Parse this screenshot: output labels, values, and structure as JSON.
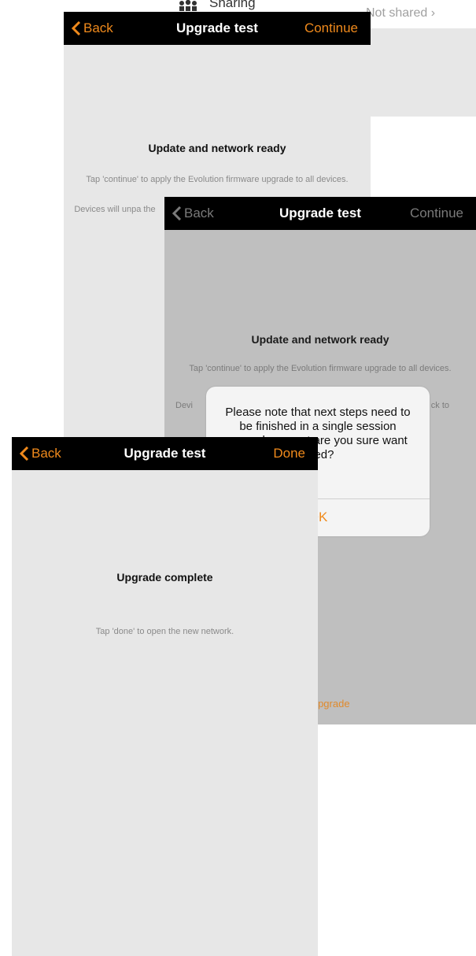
{
  "background": {
    "sharing_label": "Sharing",
    "not_shared": "Not shared"
  },
  "screen1": {
    "nav": {
      "back": "Back",
      "title": "Upgrade test",
      "action": "Continue"
    },
    "title": "Update and network ready",
    "text1": "Tap 'continue' to apply the Evolution firmware upgrade to all devices.",
    "text2": "Devices will unpa the"
  },
  "screen2": {
    "nav": {
      "back": "Back",
      "title": "Upgrade test",
      "action": "Continue"
    },
    "title": "Update and network ready",
    "text1": "Tap 'continue' to apply the Evolution firmware upgrade to all devices.",
    "text2_left": "Devi",
    "text2_right": "ck to",
    "bottom_link": "e upgrade"
  },
  "alert": {
    "message": "Please note that next steps need to be finished in a single session  upgrade cannot are you sure want ceed?",
    "ok": "OK"
  },
  "screen3": {
    "nav": {
      "back": "Back",
      "title": "Upgrade test",
      "action": "Done"
    },
    "title": "Upgrade complete",
    "text": "Tap 'done' to open the new network."
  },
  "colors": {
    "accent": "#f08a1c",
    "navbar": "#000000",
    "screen_bg": "#e7e7e7",
    "dimmed_bg": "#bfbfbf"
  },
  "icons": [
    "people-icon",
    "chevron-right-icon",
    "chevron-left-icon"
  ]
}
